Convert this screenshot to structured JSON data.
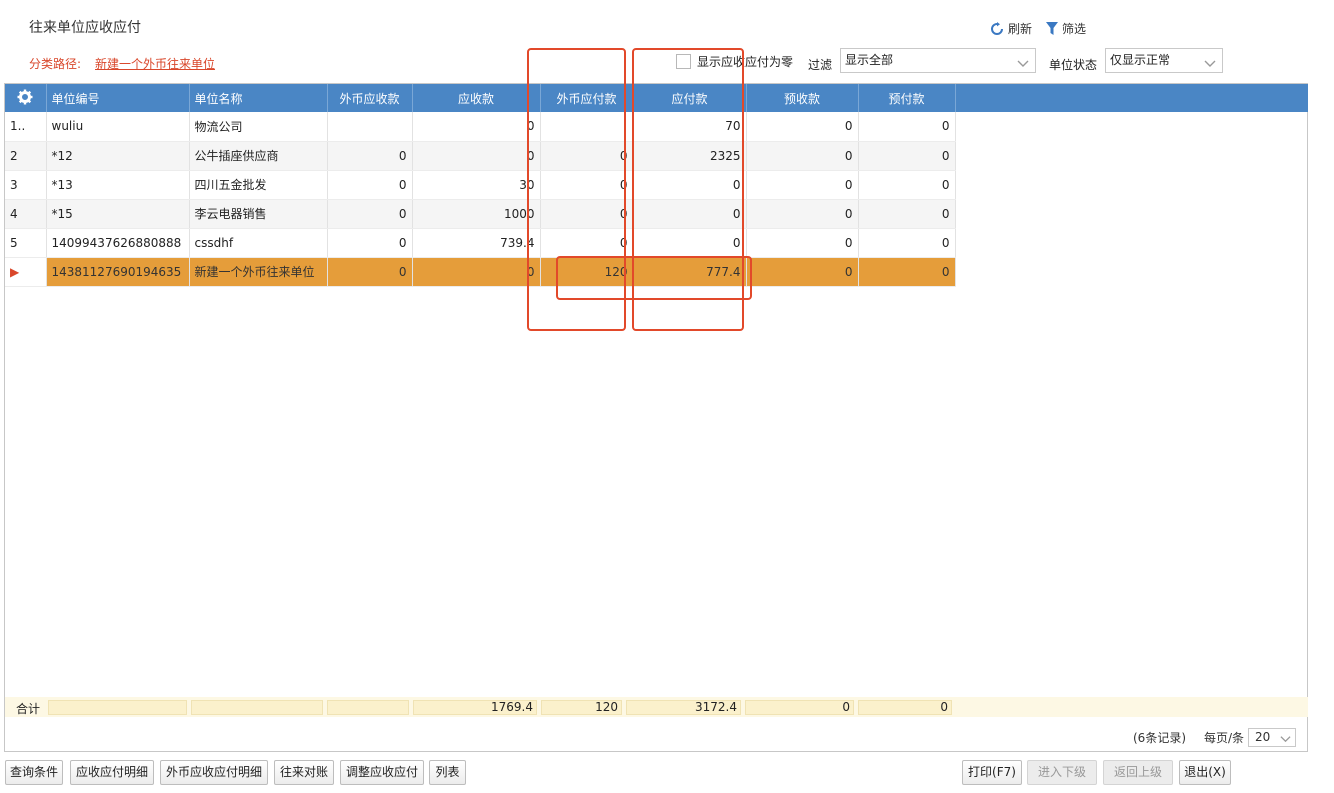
{
  "header": {
    "title": "往来单位应收应付",
    "refresh_label": "刷新",
    "filter_label": "筛选"
  },
  "path": {
    "label": "分类路径:",
    "value": "新建一个外币往来单位"
  },
  "filters": {
    "show_zero_label": "显示应收应付为零",
    "filter_label": "过滤",
    "filter_value": "显示全部",
    "status_label": "单位状态",
    "status_value": "仅显示正常"
  },
  "grid": {
    "columns": [
      "单位编号",
      "单位名称",
      "外币应收款",
      "应收款",
      "外币应付款",
      "应付款",
      "预收款",
      "预付款"
    ],
    "rows": [
      {
        "rn": "1..",
        "code": "wuliu",
        "name": "物流公司",
        "fx_recv": "",
        "recv": "0",
        "fx_pay": "",
        "pay": "70",
        "pre_recv": "0",
        "pre_pay": "0"
      },
      {
        "rn": "2",
        "code": "*12",
        "name": "公牛插座供应商",
        "fx_recv": "0",
        "recv": "0",
        "fx_pay": "0",
        "pay": "2325",
        "pre_recv": "0",
        "pre_pay": "0"
      },
      {
        "rn": "3",
        "code": "*13",
        "name": "四川五金批发",
        "fx_recv": "0",
        "recv": "30",
        "fx_pay": "0",
        "pay": "0",
        "pre_recv": "0",
        "pre_pay": "0"
      },
      {
        "rn": "4",
        "code": "*15",
        "name": "李云电器销售",
        "fx_recv": "0",
        "recv": "1000",
        "fx_pay": "0",
        "pay": "0",
        "pre_recv": "0",
        "pre_pay": "0"
      },
      {
        "rn": "5",
        "code": "14099437626880888",
        "name": "cssdhf",
        "fx_recv": "0",
        "recv": "739.4",
        "fx_pay": "0",
        "pay": "0",
        "pre_recv": "0",
        "pre_pay": "0"
      },
      {
        "rn": "▶",
        "code": "14381127690194635",
        "name": "新建一个外币往来单位",
        "fx_recv": "0",
        "recv": "0",
        "fx_pay": "120",
        "pay": "777.4",
        "pre_recv": "0",
        "pre_pay": "0"
      }
    ]
  },
  "totals": {
    "label": "合计",
    "recv": "1769.4",
    "fx_pay": "120",
    "pay": "3172.4",
    "pre_recv": "0",
    "pre_pay": "0"
  },
  "pager": {
    "count": "(6条记录)",
    "per_page_label": "每页/条",
    "per_page_value": "20"
  },
  "buttons": {
    "query": "查询条件",
    "detail": "应收应付明细",
    "fx_detail": "外币应收应付明细",
    "reconcile": "往来对账",
    "adjust": "调整应收应付",
    "list": "列表",
    "print": "打印(F7)",
    "enter_sub": "进入下级",
    "back_up": "返回上级",
    "exit": "退出(X)"
  },
  "colors": {
    "header_blue": "#4a86c5",
    "selected_row": "#e59d3a",
    "accent_red": "#d9472b"
  }
}
